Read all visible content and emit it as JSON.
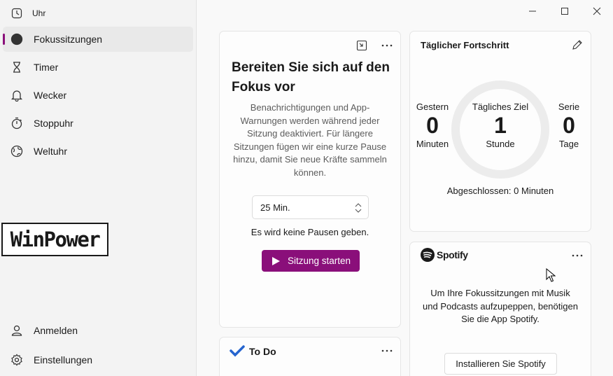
{
  "app": {
    "title": "Uhr"
  },
  "sidebar": {
    "items": [
      {
        "label": "Fokussitzungen",
        "icon": "focus-icon",
        "active": true
      },
      {
        "label": "Timer",
        "icon": "hourglass-icon"
      },
      {
        "label": "Wecker",
        "icon": "bell-icon"
      },
      {
        "label": "Stoppuhr",
        "icon": "stopwatch-icon"
      },
      {
        "label": "Weltuhr",
        "icon": "globe-icon"
      }
    ],
    "bottom": [
      {
        "label": "Anmelden",
        "icon": "person-icon"
      },
      {
        "label": "Einstellungen",
        "icon": "gear-icon"
      }
    ],
    "watermark": "WinPower"
  },
  "focus": {
    "title": "Bereiten Sie sich auf den Fokus vor",
    "description": "Benachrichtigungen und App-Warnungen werden während jeder Sitzung deaktiviert. Für längere Sitzungen fügen wir eine kurze Pause hinzu, damit Sie neue Kräfte sammeln können.",
    "duration": "25 Min.",
    "break_info": "Es wird keine Pausen geben.",
    "start_label": "Sitzung starten"
  },
  "progress": {
    "title": "Täglicher Fortschritt",
    "yesterday": {
      "label": "Gestern",
      "value": "0",
      "unit": "Minuten"
    },
    "goal": {
      "label": "Tägliches Ziel",
      "value": "1",
      "unit": "Stunde"
    },
    "streak": {
      "label": "Serie",
      "value": "0",
      "unit": "Tage"
    },
    "completed": "Abgeschlossen: 0 Minuten"
  },
  "spotify": {
    "brand": "Spotify",
    "text": "Um Ihre Fokussitzungen mit Musik und Podcasts aufzupeppen, benötigen Sie die App Spotify.",
    "install_label": "Installieren Sie Spotify"
  },
  "todo": {
    "title": "To Do"
  },
  "colors": {
    "accent": "#8a0f7a",
    "spotify": "#1a1a1a",
    "todo": "#2564cf"
  }
}
